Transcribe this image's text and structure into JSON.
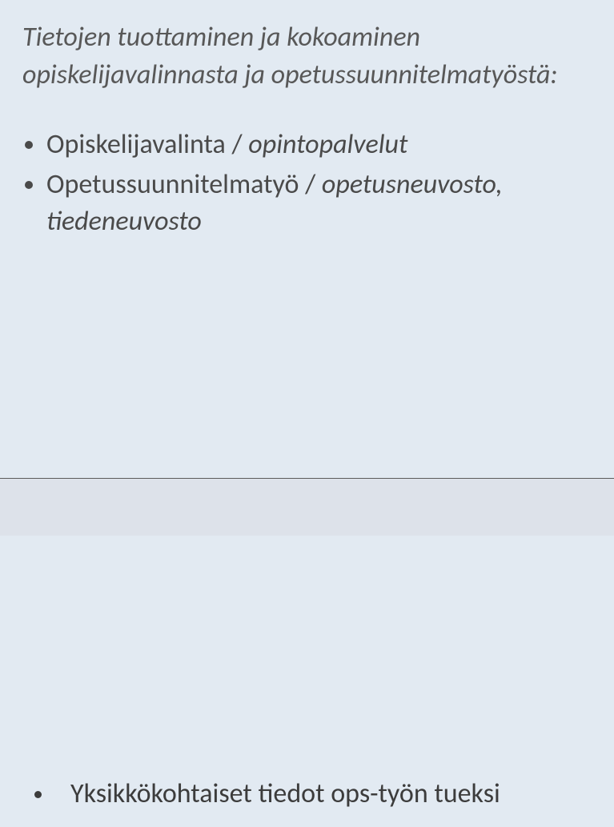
{
  "heading": "Tietojen tuottaminen ja kokoaminen opiskelijavalinnasta ja opetussuunnitelmatyöstä:",
  "topList": [
    {
      "plain": "Opiskelijavalinta / ",
      "italic": "opintopalvelut"
    },
    {
      "plain": "Opetussuunnitelmatyö  / ",
      "italic": "opetusneuvosto, tiedeneuvosto"
    }
  ],
  "bottomItem": "Yksikkökohtaiset tiedot ops-työn tueksi"
}
